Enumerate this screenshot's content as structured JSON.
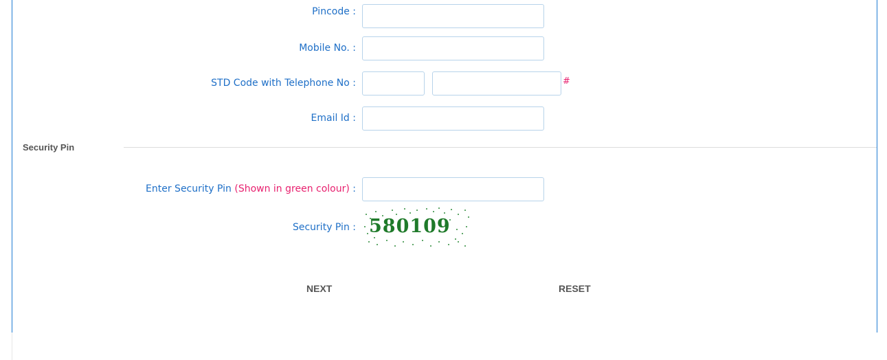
{
  "form": {
    "pincode_label": "Pincode :",
    "pincode_value": "",
    "mobile_label": "Mobile No. :",
    "mobile_value": "",
    "telephone_label": "STD Code with Telephone No :",
    "std_code_value": "",
    "telephone_value": "",
    "telephone_marker": "#",
    "email_label": "Email Id :",
    "email_value": ""
  },
  "security": {
    "section_title": "Security Pin",
    "enter_label": "Enter Security Pin",
    "enter_note": "(Shown in green colour)",
    "enter_colon": ":",
    "enter_value": "",
    "display_label": "Security Pin :",
    "captcha_text": "580109",
    "captcha_color": "#1f7a2a"
  },
  "actions": {
    "next_label": "NEXT",
    "reset_label": "RESET"
  },
  "colors": {
    "label_blue": "#1e6fc7",
    "note_pink": "#e8216f",
    "frame_blue": "#1e7bd3"
  }
}
